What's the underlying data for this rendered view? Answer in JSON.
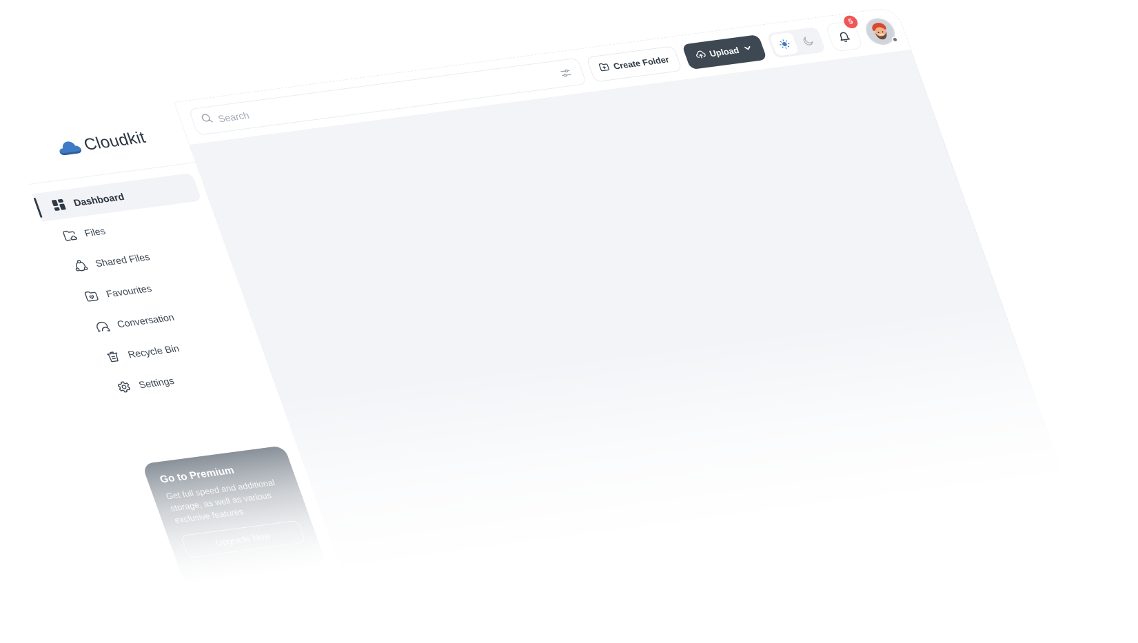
{
  "brand": {
    "name": "Cloudkit",
    "logo_icon": "cloud-icon",
    "logo_color": "#3f7bc4"
  },
  "sidebar": {
    "items": [
      {
        "label": "Dashboard",
        "icon": "dashboard-grid-icon",
        "active": true
      },
      {
        "label": "Files",
        "icon": "folder-cloud-icon",
        "active": false
      },
      {
        "label": "Shared Files",
        "icon": "share-nodes-icon",
        "active": false
      },
      {
        "label": "Favourites",
        "icon": "folder-heart-icon",
        "active": false
      },
      {
        "label": "Conversation",
        "icon": "chat-bubbles-icon",
        "active": false
      },
      {
        "label": "Recycle Bin",
        "icon": "trash-icon",
        "active": false
      },
      {
        "label": "Settings",
        "icon": "gear-icon",
        "active": false
      }
    ],
    "premium": {
      "title": "Go to Premium",
      "text": "Get full speed and additional storage, as well as various exclusive features.",
      "button_label": "Upgrade Now"
    }
  },
  "topbar": {
    "search": {
      "placeholder": "Search",
      "value": "",
      "icon": "search-icon"
    },
    "filter_icon": "sliders-icon",
    "create_folder_label": "Create Folder",
    "create_folder_icon": "folder-plus-icon",
    "upload_label": "Upload",
    "upload_icon": "cloud-upload-icon",
    "upload_caret_icon": "chevron-down-icon",
    "theme": {
      "selected": "light",
      "options": [
        "light",
        "dark"
      ],
      "light_icon": "sun-icon",
      "dark_icon": "moon-icon",
      "accent": "#3f7bc4"
    },
    "notifications": {
      "count": "5",
      "icon": "bell-icon",
      "badge_color": "#f05555"
    },
    "avatar": {
      "icon": "user-avatar",
      "status": "offline"
    }
  },
  "colors": {
    "primary_dark": "#3e4853",
    "content_bg": "#f2f4f7",
    "accent_blue": "#3f7bc4"
  }
}
